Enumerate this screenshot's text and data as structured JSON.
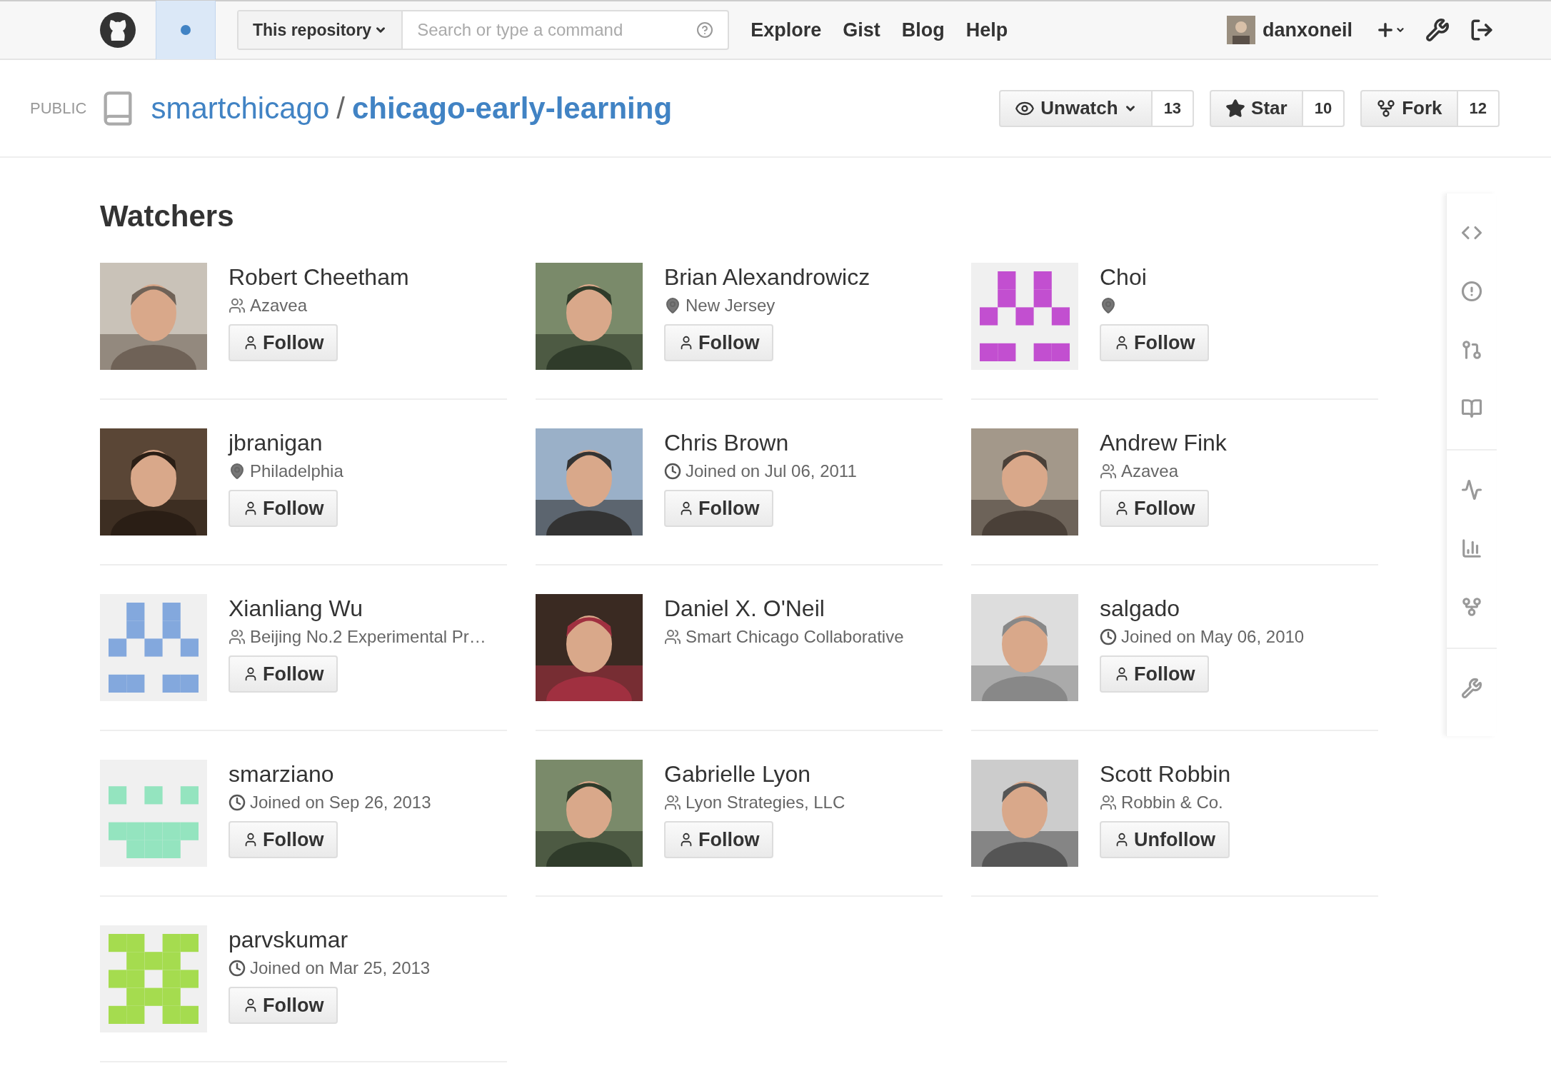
{
  "header": {
    "scope": "This repository",
    "search_placeholder": "Search or type a command",
    "nav": [
      "Explore",
      "Gist",
      "Blog",
      "Help"
    ],
    "user": "danxoneil"
  },
  "repo": {
    "visibility": "PUBLIC",
    "owner": "smartchicago",
    "separator": "/",
    "name": "chicago-early-learning",
    "actions": [
      {
        "kind": "watch",
        "label": "Unwatch",
        "count": "13"
      },
      {
        "kind": "star",
        "label": "Star",
        "count": "10"
      },
      {
        "kind": "fork",
        "label": "Fork",
        "count": "12"
      }
    ]
  },
  "title": "Watchers",
  "watchers": [
    {
      "name": "Robert Cheetham",
      "meta": {
        "kind": "org",
        "text": "Azavea"
      },
      "button": "Follow"
    },
    {
      "name": "Brian Alexandrowicz",
      "meta": {
        "kind": "location",
        "text": "New Jersey"
      },
      "button": "Follow"
    },
    {
      "name": "Choi",
      "meta": {
        "kind": "location"
      },
      "avatar": {
        "kind": "identicon",
        "color": "#c24fd0"
      },
      "button": "Follow"
    },
    {
      "name": "jbranigan",
      "meta": {
        "kind": "location",
        "text": "Philadelphia"
      },
      "button": "Follow"
    },
    {
      "name": "Chris Brown",
      "meta": {
        "kind": "joined",
        "text": "Joined on Jul 06, 2011"
      },
      "button": "Follow"
    },
    {
      "name": "Andrew Fink",
      "meta": {
        "kind": "org",
        "text": "Azavea"
      },
      "button": "Follow"
    },
    {
      "name": "Xianliang Wu",
      "meta": {
        "kind": "org",
        "text": "Beijing No.2 Experimental Pr…"
      },
      "avatar": {
        "kind": "identicon",
        "color": "#83a8dd"
      },
      "button": "Follow"
    },
    {
      "name": "Daniel X. O'Neil",
      "meta": {
        "kind": "org",
        "text": "Smart Chicago Collaborative"
      }
    },
    {
      "name": "salgado",
      "meta": {
        "kind": "joined",
        "text": "Joined on May 06, 2010"
      },
      "button": "Follow"
    },
    {
      "name": "smarziano",
      "meta": {
        "kind": "joined",
        "text": "Joined on Sep 26, 2013"
      },
      "avatar": {
        "kind": "identicon",
        "color": "#94e4bf"
      },
      "button": "Follow"
    },
    {
      "name": "Gabrielle Lyon",
      "meta": {
        "kind": "org",
        "text": "Lyon Strategies, LLC"
      },
      "button": "Follow"
    },
    {
      "name": "Scott Robbin",
      "meta": {
        "kind": "org",
        "text": "Robbin & Co."
      },
      "button": "Unfollow"
    },
    {
      "name": "parvskumar",
      "meta": {
        "kind": "joined",
        "text": "Joined on Mar 25, 2013"
      },
      "avatar": {
        "kind": "identicon",
        "color": "#a5dc4f"
      },
      "button": "Follow"
    }
  ]
}
